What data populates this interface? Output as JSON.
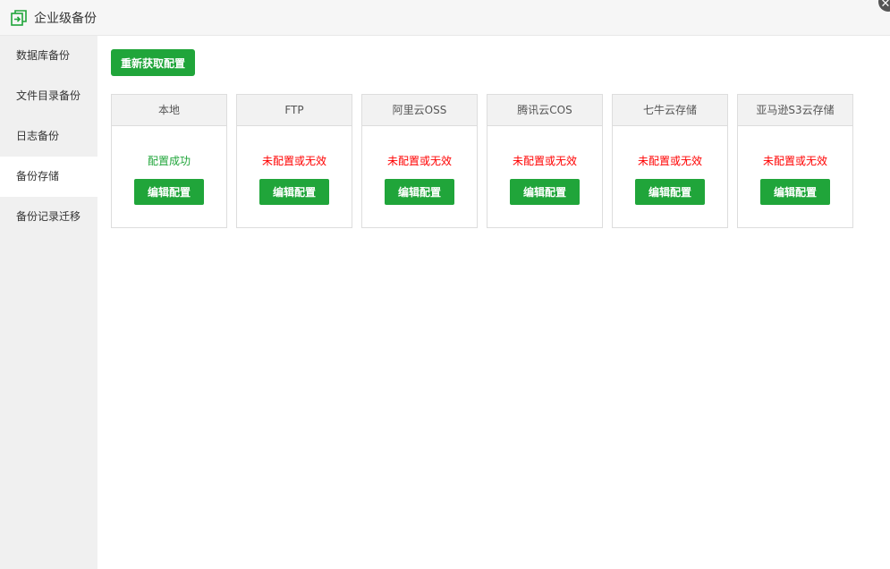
{
  "window": {
    "title": "企业级备份",
    "icon": "backup-app-icon",
    "close_glyph": "✕"
  },
  "sidebar": {
    "items": [
      {
        "label": "数据库备份",
        "active": false
      },
      {
        "label": "文件目录备份",
        "active": false
      },
      {
        "label": "日志备份",
        "active": false
      },
      {
        "label": "备份存储",
        "active": true
      },
      {
        "label": "备份记录迁移",
        "active": false
      }
    ]
  },
  "main": {
    "refresh_label": "重新获取配置",
    "cards": [
      {
        "name": "本地",
        "status": "配置成功",
        "status_type": "ok",
        "edit_label": "编辑配置"
      },
      {
        "name": "FTP",
        "status": "未配置或无效",
        "status_type": "bad",
        "edit_label": "编辑配置"
      },
      {
        "name": "阿里云OSS",
        "status": "未配置或无效",
        "status_type": "bad",
        "edit_label": "编辑配置"
      },
      {
        "name": "腾讯云COS",
        "status": "未配置或无效",
        "status_type": "bad",
        "edit_label": "编辑配置"
      },
      {
        "name": "七牛云存储",
        "status": "未配置或无效",
        "status_type": "bad",
        "edit_label": "编辑配置"
      },
      {
        "name": "亚马逊S3云存储",
        "status": "未配置或无效",
        "status_type": "bad",
        "edit_label": "编辑配置"
      }
    ]
  },
  "colors": {
    "accent": "#20a53a",
    "error": "#ff0000",
    "sidebar_bg": "#f0f0f0"
  }
}
